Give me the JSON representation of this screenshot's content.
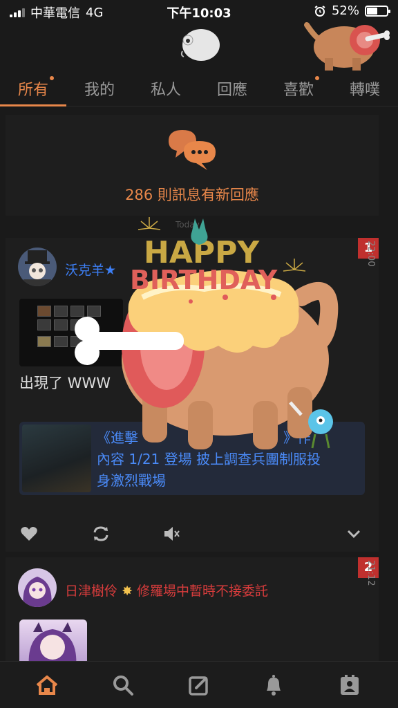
{
  "status_bar": {
    "carrier": "中華電信",
    "network": "4G",
    "time": "下午10:03",
    "battery": "52%",
    "battery_level": 0.52
  },
  "tabs": [
    {
      "label": "所有",
      "active": true,
      "dot": true
    },
    {
      "label": "我的",
      "active": false,
      "dot": false
    },
    {
      "label": "私人",
      "active": false,
      "dot": false
    },
    {
      "label": "回應",
      "active": false,
      "dot": false
    },
    {
      "label": "喜歡",
      "active": false,
      "dot": true
    },
    {
      "label": "轉噗",
      "active": false,
      "dot": false
    }
  ],
  "notice": {
    "text": "286 則訊息有新回應"
  },
  "divider_label": "Today",
  "posts": [
    {
      "badge": "1",
      "time": "22:00",
      "author": "沃克羊★",
      "text": "出現了 WWW",
      "link_title": "《進擊",
      "link_title_tail": "》作",
      "link_title_2": "內容 1/21 登場 披上調查兵團制服投",
      "link_title_3": "身激烈戰場"
    },
    {
      "badge": "2",
      "time": "21:12",
      "author": "日津樹伶",
      "author_suffix": "修羅場中暫時不接委託"
    }
  ],
  "overlay": {
    "line1": "HAPPY",
    "line2": "BIRTHDAY"
  },
  "colors": {
    "accent": "#e8874a",
    "link": "#3d7ff5",
    "badge": "#c0302e",
    "background": "#1a1a1a"
  },
  "icons": {
    "nav": [
      "home-icon",
      "search-icon",
      "compose-icon",
      "bell-icon",
      "profile-card-icon"
    ],
    "actions": [
      "heart-icon",
      "replurk-icon",
      "mute-icon",
      "chevron-down-icon"
    ]
  }
}
